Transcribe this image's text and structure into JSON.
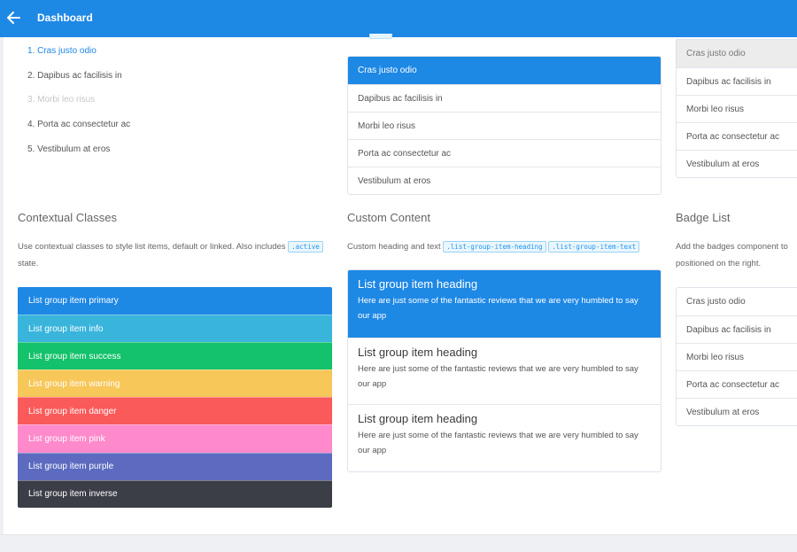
{
  "header": {
    "title": "Dashboard",
    "back_icon": "arrow-left-icon"
  },
  "ordered_list": [
    {
      "text": "1. Cras justo odio",
      "state": "link"
    },
    {
      "text": "2. Dapibus ac facilisis in",
      "state": "default"
    },
    {
      "text": "3. Morbi leo risus",
      "state": "disabled"
    },
    {
      "text": "4. Porta ac consectetur ac",
      "state": "default"
    },
    {
      "text": "5. Vestibulum at eros",
      "state": "default"
    }
  ],
  "linked_list": [
    "Cras justo odio",
    "Dapibus ac facilisis in",
    "Morbi leo risus",
    "Porta ac consectetur ac",
    "Vestibulum at eros"
  ],
  "hover_list": [
    "Cras justo odio",
    "Dapibus ac facilisis in",
    "Morbi leo risus",
    "Porta ac consectetur ac",
    "Vestibulum at eros"
  ],
  "contextual": {
    "title": "Contextual Classes",
    "desc_prefix": "Use contextual classes to style list items, default or linked. Also includes",
    "desc_code": ".active",
    "desc_suffix": "state.",
    "items": [
      {
        "label": "List group item primary",
        "color": "#1e88e5"
      },
      {
        "label": "List group item info",
        "color": "#39b5dc"
      },
      {
        "label": "List group item success",
        "color": "#13c26a"
      },
      {
        "label": "List group item warning",
        "color": "#f7c75a"
      },
      {
        "label": "List group item danger",
        "color": "#fa5a5a"
      },
      {
        "label": "List group item pink",
        "color": "#ff8acb"
      },
      {
        "label": "List group item purple",
        "color": "#5c6bc0"
      },
      {
        "label": "List group item inverse",
        "color": "#3b3e47"
      }
    ]
  },
  "custom": {
    "title": "Custom Content",
    "desc_prefix": "Custom heading and text",
    "code1": ".list-group-item-heading",
    "code2": ".list-group-item-text",
    "items": [
      {
        "heading": "List group item heading",
        "text": "Here are just some of the fantastic reviews that we are very humbled to say our app"
      },
      {
        "heading": "List group item heading",
        "text": "Here are just some of the fantastic reviews that we are very humbled to say our app"
      },
      {
        "heading": "List group item heading",
        "text": "Here are just some of the fantastic reviews that we are very humbled to say our app"
      }
    ]
  },
  "badge": {
    "title": "Badge List",
    "desc_line1": "Add the badges component to",
    "desc_line2": "positioned on the right.",
    "items": [
      "Cras justo odio",
      "Dapibus ac facilisis in",
      "Morbi leo risus",
      "Porta ac consectetur ac",
      "Vestibulum at eros"
    ]
  }
}
